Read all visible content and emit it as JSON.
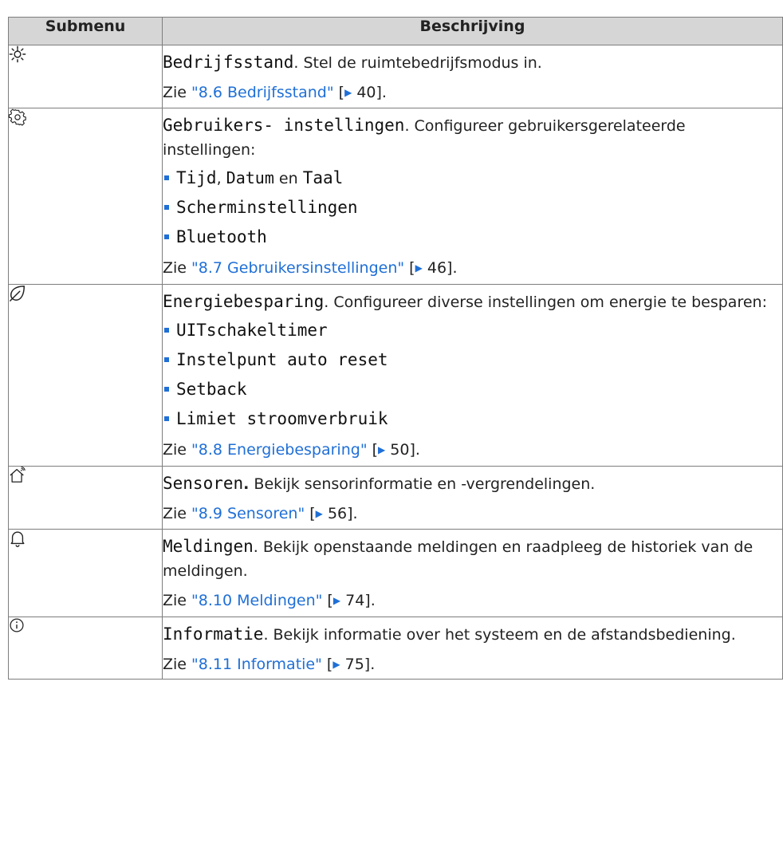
{
  "header": {
    "col1": "Submenu",
    "col2": "Beschrijving"
  },
  "rows": [
    {
      "icon": "sun-icon",
      "title": "Bedrijfsstand",
      "text": ". Stel de ruimtebedrijfsmodus in.",
      "see_prefix": "Zie ",
      "link": "\"8.6 Bedrijfsstand\"",
      "bracket_open": " [",
      "page": " 40",
      "bracket_close": "]."
    },
    {
      "icon": "gear-icon",
      "title": "Gebruikers- instellingen",
      "text": ". Configureer gebruikersgerelateerde instellingen:",
      "item1_a": "Tijd",
      "item1_b": ", ",
      "item1_c": "Datum",
      "item1_d": " en ",
      "item1_e": "Taal",
      "item2": "Scherminstellingen",
      "item3": "Bluetooth",
      "see_prefix": "Zie ",
      "link": "\"8.7 Gebruikersinstellingen\"",
      "bracket_open": " [",
      "page": " 46",
      "bracket_close": "]."
    },
    {
      "icon": "leaf-icon",
      "title": "Energiebesparing",
      "text": ". Configureer diverse instellingen om energie te besparen:",
      "item1": "UITschakeltimer",
      "item2": "Instelpunt auto reset",
      "item3": "Setback",
      "item4": "Limiet stroomverbruik",
      "see_prefix": "Zie ",
      "link": "\"8.8 Energiebesparing\"",
      "bracket_open": " [",
      "page": " 50",
      "bracket_close": "]."
    },
    {
      "icon": "house-sensor-icon",
      "title": "Sensoren",
      "title_suffix": ".",
      "text": " Bekijk sensorinformatie en -vergrendelingen.",
      "see_prefix": "Zie ",
      "link": "\"8.9 Sensoren\"",
      "bracket_open": " [",
      "page": " 56",
      "bracket_close": "]."
    },
    {
      "icon": "bell-icon",
      "title": "Meldingen",
      "text": ". Bekijk openstaande meldingen en raadpleeg de historiek van de meldingen.",
      "see_prefix": "Zie ",
      "link": "\"8.10 Meldingen\"",
      "bracket_open": " [",
      "page": " 74",
      "bracket_close": "]."
    },
    {
      "icon": "info-icon",
      "title": "Informatie",
      "text": ". Bekijk informatie over het systeem en de afstandsbediening.",
      "see_prefix": "Zie ",
      "link": "\"8.11 Informatie\"",
      "bracket_open": " [",
      "page": " 75",
      "bracket_close": "]."
    }
  ],
  "colors": {
    "header_bg": "#d6d6d6",
    "border": "#7d7d7d",
    "link": "#1f6fd6",
    "bullet": "#1f6fd6"
  }
}
